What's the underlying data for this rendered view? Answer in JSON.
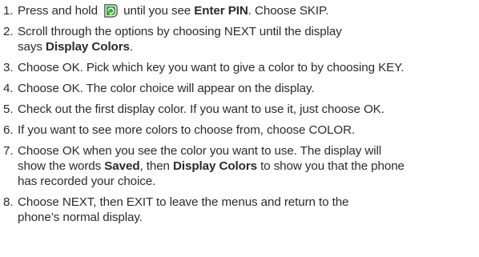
{
  "steps": [
    {
      "num": "1.",
      "parts": [
        {
          "text": "Press and hold "
        },
        {
          "icon": "menu-key-icon"
        },
        {
          "text": " until you see "
        },
        {
          "text": "Enter PIN",
          "bold": true
        },
        {
          "text": ". Choose SKIP."
        }
      ]
    },
    {
      "num": "2.",
      "parts": [
        {
          "text": "Scroll through the options by choosing NEXT until the display"
        },
        {
          "break": true
        },
        {
          "text": "says "
        },
        {
          "text": "Display Colors",
          "bold": true
        },
        {
          "text": "."
        }
      ]
    },
    {
      "num": "3.",
      "parts": [
        {
          "text": "Choose OK. Pick which key you want to give a color to by choosing KEY."
        }
      ]
    },
    {
      "num": "4.",
      "parts": [
        {
          "text": "Choose OK. The color choice will appear on the display."
        }
      ]
    },
    {
      "num": "5.",
      "parts": [
        {
          "text": "Check out the first display color. If you want to use it, just choose OK."
        }
      ]
    },
    {
      "num": "6.",
      "parts": [
        {
          "text": "If you want to see more colors to choose from, choose COLOR."
        }
      ]
    },
    {
      "num": "7.",
      "parts": [
        {
          "text": "Choose OK when you see the color you want to use. The display will"
        },
        {
          "break": true
        },
        {
          "text": "show the words "
        },
        {
          "text": "Saved",
          "bold": true
        },
        {
          "text": ", then "
        },
        {
          "text": "Display Colors",
          "bold": true
        },
        {
          "text": " to show you that the phone"
        },
        {
          "break": true
        },
        {
          "text": "has recorded your choice."
        }
      ]
    },
    {
      "num": "8.",
      "parts": [
        {
          "text": "Choose NEXT, then EXIT to leave the menus and return to the"
        },
        {
          "break": true
        },
        {
          "text": "phone’s normal display."
        }
      ]
    }
  ],
  "colors": {
    "text": "#2b2b2b",
    "icon_green": "#39a935",
    "icon_outline": "#3a3a3a"
  }
}
